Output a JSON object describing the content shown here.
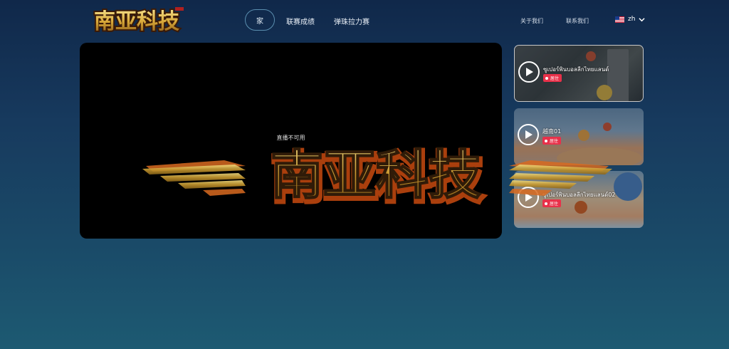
{
  "header": {
    "logo_alt": "南亚科技",
    "nav": [
      {
        "label": "家",
        "active": true
      },
      {
        "label": "联赛成绩"
      },
      {
        "label": "弹珠拉力赛"
      }
    ],
    "links": [
      "关于我们",
      "联系我们"
    ],
    "language": {
      "code": "zh",
      "flag": "us-flag-icon"
    }
  },
  "player": {
    "message": "直播不可用"
  },
  "watermark": {
    "text": "南亚科技"
  },
  "streams": [
    {
      "title": "ซูเปอร์พินบอลลีกไทยแลนด์",
      "badge": "居住"
    },
    {
      "title": "越南01",
      "badge": "居住"
    },
    {
      "title": "ซูเปอร์พินบอลลีกไทยแลนด์02",
      "badge": "居住"
    }
  ],
  "colors": {
    "background_top": "#10284a",
    "background_bottom": "#1d5a72",
    "live_badge": "#e8314a",
    "logo_gold": "#d8a838"
  }
}
